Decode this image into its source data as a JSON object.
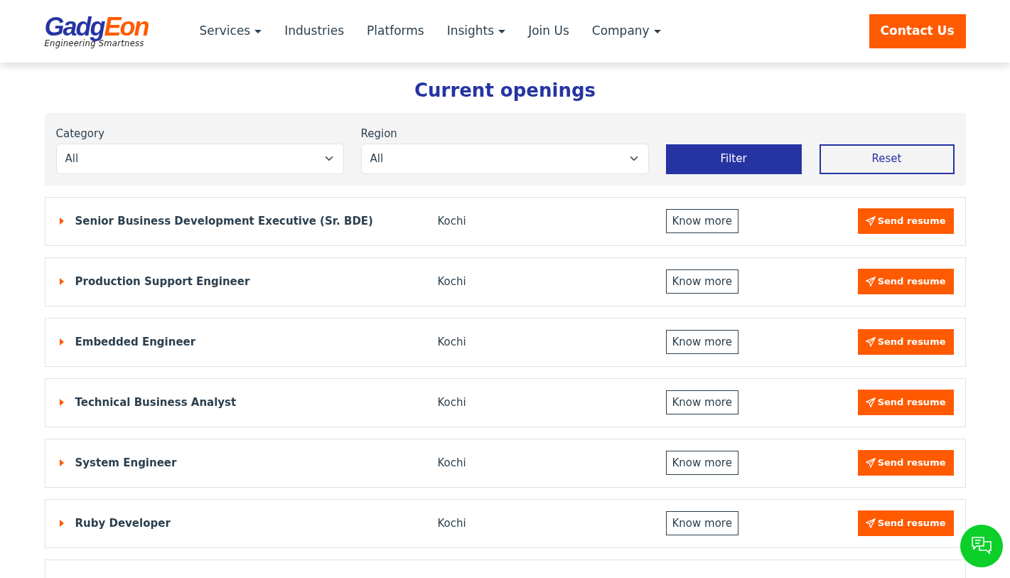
{
  "logo": {
    "parts": [
      "Gadg",
      "Eon"
    ],
    "tagline": "Engineering Smartness"
  },
  "nav": [
    {
      "label": "Services",
      "kind": "dropdown"
    },
    {
      "label": "Industries",
      "kind": "link"
    },
    {
      "label": "Platforms",
      "kind": "link"
    },
    {
      "label": "Insights",
      "kind": "dropdown"
    },
    {
      "label": "Join Us",
      "kind": "link"
    },
    {
      "label": "Company",
      "kind": "dropdown"
    }
  ],
  "contact_button": "Contact Us",
  "title": "Current openings",
  "filters": [
    {
      "label": "Category",
      "value": "All"
    },
    {
      "label": "Region",
      "value": "All"
    }
  ],
  "filter_button": "Filter",
  "reset_button": "Reset",
  "jobs": [
    {
      "title": "Senior Business Development Executive (Sr. BDE)",
      "location": "Kochi",
      "more": "Know more",
      "send": "Send resume"
    },
    {
      "title": "Production Support Engineer",
      "location": "Kochi",
      "more": "Know more",
      "send": "Send resume"
    },
    {
      "title": "Embedded Engineer",
      "location": "Kochi",
      "more": "Know more",
      "send": "Send resume"
    },
    {
      "title": "Technical Business Analyst",
      "location": "Kochi",
      "more": "Know more",
      "send": "Send resume"
    },
    {
      "title": "System Engineer",
      "location": "Kochi",
      "more": "Know more",
      "send": "Send resume"
    },
    {
      "title": "Ruby Developer",
      "location": "Kochi",
      "more": "Know more",
      "send": "Send resume"
    }
  ]
}
